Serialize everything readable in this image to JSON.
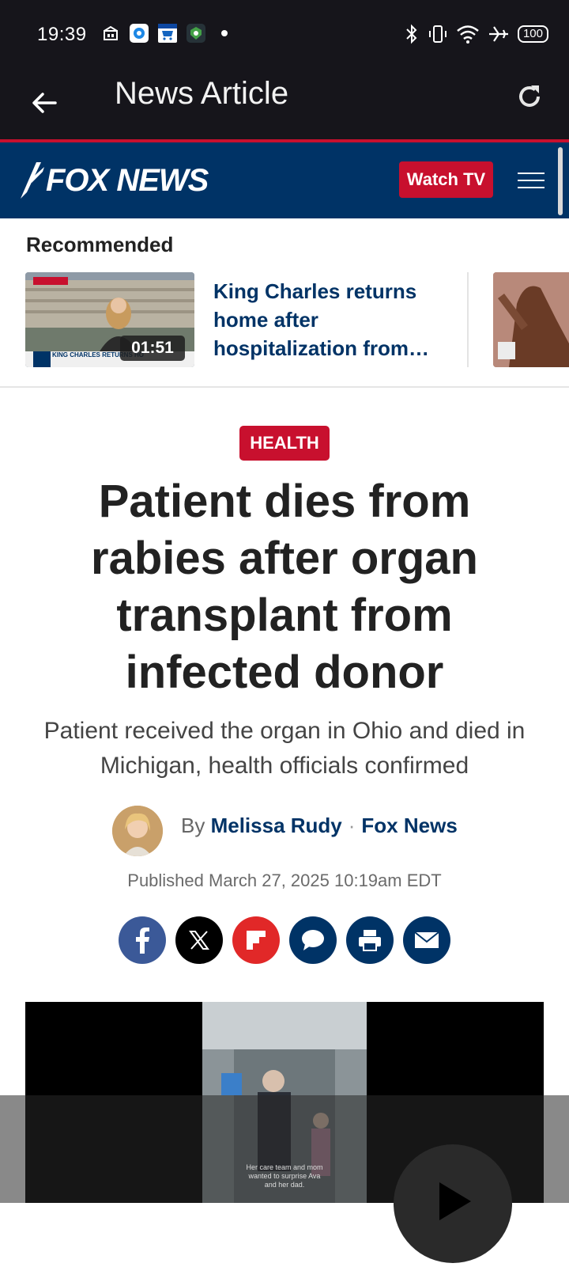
{
  "status_bar": {
    "time": "19:39",
    "battery": "100"
  },
  "app_bar": {
    "title": "News Article"
  },
  "site": {
    "logo_text": "FOX NEWS",
    "watch_label": "Watch TV"
  },
  "recommended": {
    "heading": "Recommended",
    "items": [
      {
        "title": "King Charles returns home after hospitalization from…",
        "duration": "01:51",
        "thumb_caption": "KING CHARLES RETURNS HO"
      }
    ]
  },
  "article": {
    "category": "HEALTH",
    "headline": "Patient dies from rabies after organ transplant from infected donor",
    "subheadline": "Patient received the organ in Ohio and died in Michigan, health officials confirmed",
    "by_label": "By",
    "author": "Melissa Rudy",
    "outlet": "Fox News",
    "published": "Published March 27, 2025 10:19am EDT"
  },
  "share": [
    "facebook-icon",
    "x-icon",
    "flipboard-icon",
    "comment-icon",
    "print-icon",
    "email-icon"
  ],
  "video": {
    "caption": "Her care team and mom wanted to surprise Ava and her dad."
  },
  "colors": {
    "fox_blue": "#003366",
    "fox_red": "#c8102e",
    "status_bg": "#16151b"
  }
}
